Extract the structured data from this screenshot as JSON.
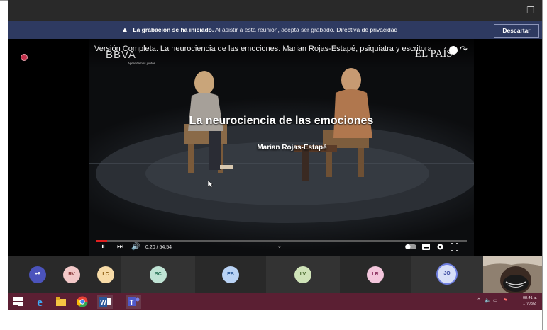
{
  "window": {
    "minimize_glyph": "–",
    "restore_glyph": "❐"
  },
  "banner": {
    "warning_icon": "warning-icon",
    "title": "La grabación se ha iniciado.",
    "message": "Al asistir a esta reunión, acepta ser grabado.",
    "privacy_link": "Directiva de privacidad",
    "dismiss_label": "Descartar"
  },
  "video": {
    "title": "Versión Completa. La neurociencia de las emociones. Marian Rojas-Estapé, psiquiatra y escritora",
    "brand_left": "BBVA",
    "brand_left_sub": "Aprendemos juntos",
    "brand_right": "EL PAÍS",
    "headline": "La neurociencia de las emociones",
    "subheadline": "Marian Rojas-Estapé",
    "time": "0:20 / 54:54",
    "progress": 0.006,
    "controls": {
      "pause": "⏸",
      "next": "⏭",
      "volume": "🔊",
      "chevron": "⌄",
      "share": "↷"
    }
  },
  "participants": [
    {
      "initials": "+8",
      "bg": "#4b53bc",
      "fg": "#ffffff"
    },
    {
      "initials": "RV",
      "bg": "#f2c8c8",
      "fg": "#8a3a3a"
    },
    {
      "initials": "LC",
      "bg": "#f7dba7",
      "fg": "#8a5a10"
    },
    {
      "initials": "SC",
      "bg": "#bfe3d4",
      "fg": "#1f6b4f"
    },
    {
      "initials": "EB",
      "bg": "#b9d3f5",
      "fg": "#1d4f91"
    },
    {
      "initials": "LV",
      "bg": "#cfe3b8",
      "fg": "#45662a"
    },
    {
      "initials": "LR",
      "bg": "#f3c6dc",
      "fg": "#8a2f5e"
    },
    {
      "initials": "JO",
      "bg": "#d7def7",
      "fg": "#3b4aa0"
    }
  ],
  "taskbar": {
    "apps": [
      "windows-start",
      "internet-explorer",
      "file-explorer",
      "chrome",
      "word",
      "teams"
    ],
    "tray_time": "08:41 a.",
    "tray_date": "17/08/2"
  },
  "colors": {
    "banner": "#2e3a61",
    "taskbar": "#5b1f33",
    "progress": "#e02020",
    "recording": "#c4314b"
  }
}
